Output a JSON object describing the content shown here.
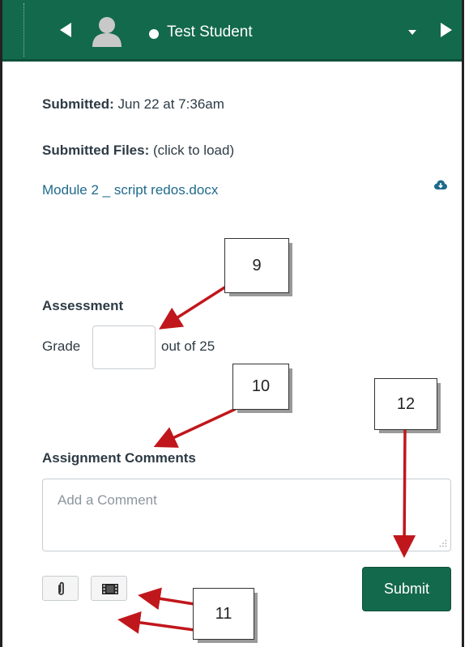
{
  "header": {
    "student_name": "Test Student",
    "prev_icon": "triangle-left-icon",
    "next_icon": "triangle-right-icon",
    "dropdown_icon": "caret-down-icon"
  },
  "submission": {
    "submitted_label": "Submitted:",
    "submitted_value": "Jun 22 at 7:36am",
    "files_label": "Submitted Files:",
    "files_hint": "(click to load)",
    "file_name": "Module 2 _ script redos.docx"
  },
  "assessment": {
    "heading": "Assessment",
    "grade_label": "Grade",
    "grade_value": "",
    "out_of": "out of 25"
  },
  "comments": {
    "heading": "Assignment Comments",
    "placeholder": "Add a Comment",
    "submit_label": "Submit"
  },
  "callouts": {
    "c9": "9",
    "c10": "10",
    "c11": "11",
    "c12": "12"
  },
  "colors": {
    "header_bg": "#13694b",
    "link": "#1f6a8c",
    "arrow": "#c0171c"
  }
}
